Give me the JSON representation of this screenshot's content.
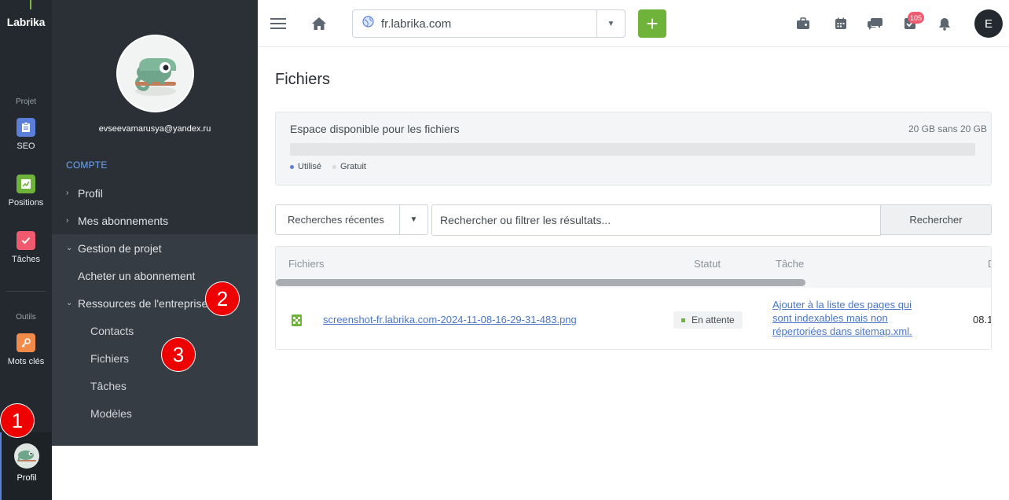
{
  "rail": {
    "logo": "Labrika",
    "section_projet": "Projet",
    "section_outils": "Outils",
    "items": [
      {
        "label": "SEO",
        "icon": "clipboard-icon",
        "color": "#5b7fd8"
      },
      {
        "label": "Positions",
        "icon": "chart-icon",
        "color": "#6fb33a"
      },
      {
        "label": "Tâches",
        "icon": "checkbox-icon",
        "color": "#ef5a6f"
      },
      {
        "label": "Mots clés",
        "icon": "key-icon",
        "color": "#f28b4a"
      }
    ],
    "profile_label": "Profil"
  },
  "sidebar": {
    "email": "evseevamarusya@yandex.ru",
    "section": "COMPTE",
    "items": [
      {
        "label": "Profil",
        "expanded": false
      },
      {
        "label": "Mes abonnements",
        "expanded": false
      },
      {
        "label": "Gestion de projet",
        "expanded": true
      },
      {
        "label": "Acheter un abonnement"
      },
      {
        "label": "Ressources de l'entreprise",
        "expanded": true
      }
    ],
    "subitems": [
      "Contacts",
      "Fichiers",
      "Tâches",
      "Modèles"
    ]
  },
  "markers": [
    "1",
    "2",
    "3"
  ],
  "topbar": {
    "domain": "fr.labrika.com",
    "add_label": "+",
    "notification_count": "105",
    "user_initial": "E"
  },
  "page": {
    "title": "Fichiers",
    "storage": {
      "label": "Espace disponible pour les fichiers",
      "value": "20 GB sans 20 GB",
      "used_fraction": 0,
      "legend_used": "Utilisé",
      "legend_free": "Gratuit",
      "used_color": "#5b7fd8",
      "free_color": "#d8dbde"
    },
    "search": {
      "recent_label": "Recherches récentes",
      "placeholder": "Rechercher ou filtrer les résultats...",
      "button": "Rechercher"
    },
    "table": {
      "columns": [
        "Fichiers",
        "Statut",
        "Tâche",
        "D"
      ],
      "rows": [
        {
          "file": "screenshot-fr.labrika.com-2024-11-08-16-29-31-483.png",
          "status": "En attente",
          "task": "Ajouter à la liste des pages qui sont indexables mais non répertoriées dans sitemap.xml.",
          "date": "08.1"
        }
      ]
    }
  }
}
